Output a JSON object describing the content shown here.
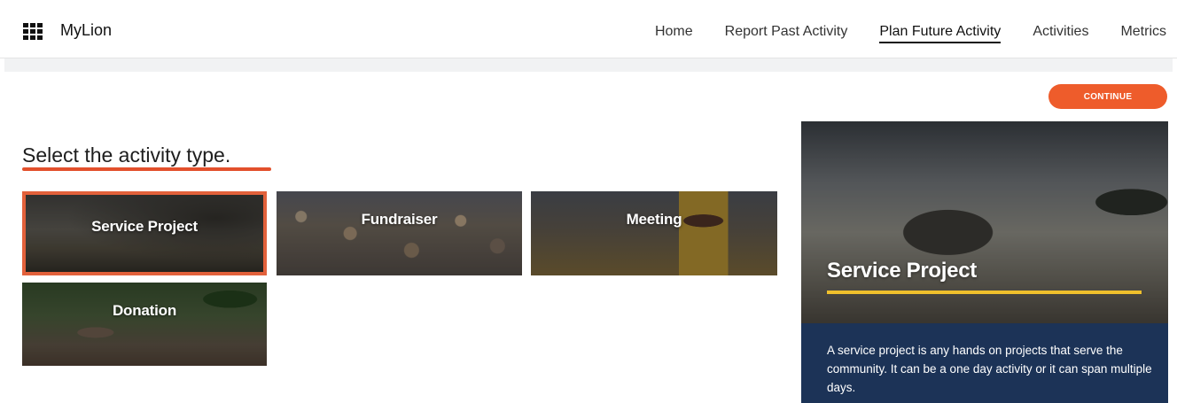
{
  "header": {
    "brand": "MyLion",
    "nav": [
      {
        "label": "Home"
      },
      {
        "label": "Report Past Activity"
      },
      {
        "label": "Plan Future Activity",
        "active": true
      },
      {
        "label": "Activities"
      },
      {
        "label": "Metrics"
      }
    ]
  },
  "actions": {
    "continue_label": "CONTINUE"
  },
  "main": {
    "heading": "Select the activity type.",
    "tiles": [
      {
        "label": "Service Project",
        "selected": true
      },
      {
        "label": "Fundraiser"
      },
      {
        "label": "Meeting"
      },
      {
        "label": "Donation"
      }
    ]
  },
  "preview": {
    "title": "Service Project",
    "description": "A service project is any hands on projects that serve the community. It can be a one day activity or it can span multiple days."
  },
  "colors": {
    "accent": "#ee5c2b",
    "selected_border": "#e2613b",
    "preview_panel": "#1c3357",
    "title_underline": "#f0c02c"
  },
  "icons": {
    "menu": "grid-menu-icon"
  }
}
